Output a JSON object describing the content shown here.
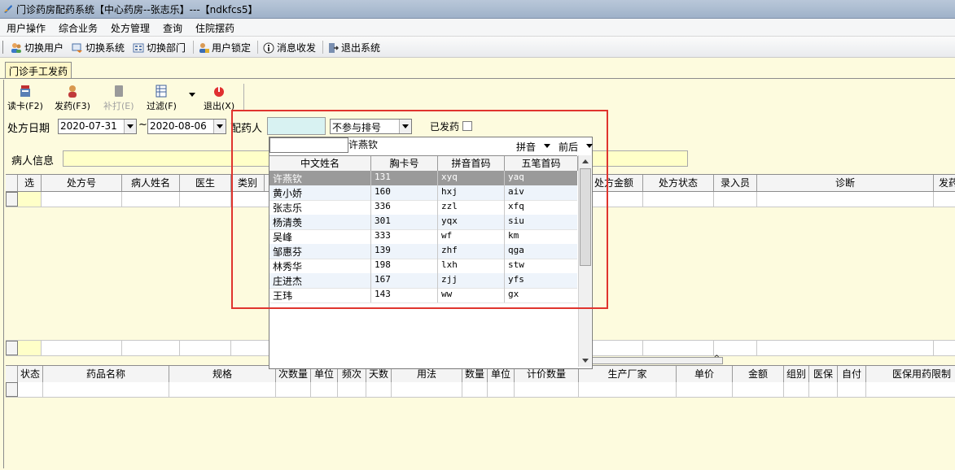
{
  "window": {
    "title": "门诊药房配药系统【中心药房--张志乐】---【ndkfcs5】"
  },
  "menu": [
    "用户操作",
    "综合业务",
    "处方管理",
    "查询",
    "住院摆药"
  ],
  "toolbar": {
    "switch_user": "切换用户",
    "switch_system": "切换系统",
    "switch_dept": "切换部门",
    "user_lock": "用户锁定",
    "message": "消息收发",
    "exit_system": "退出系统"
  },
  "tab": {
    "label": "门诊手工发药"
  },
  "actions": {
    "read_card": "读卡(F2)",
    "dispense": "发药(F3)",
    "reprint": "补打(E)",
    "filter": "过滤(F)",
    "exit": "退出(X)"
  },
  "filters": {
    "date_label": "处方日期",
    "date_from": "2020-07-31",
    "tilde": "~",
    "date_to": "2020-08-06",
    "pharmacist_label": "配药人",
    "pharmacist_value": "",
    "queue_option": "不参与排号",
    "dispensed_label": "已发药",
    "patient_info_label": "病人信息"
  },
  "rx_grid": {
    "columns": [
      "选",
      "处方号",
      "病人姓名",
      "医生",
      "类别",
      "处方金额",
      "处方状态",
      "录入员",
      "诊断",
      "发药"
    ]
  },
  "drug_grid": {
    "columns": [
      "状态",
      "药品名称",
      "规格",
      "次数量",
      "单位",
      "频次",
      "天数",
      "用法",
      "数量",
      "单位",
      "计价数量",
      "生产厂家",
      "单价",
      "金额",
      "组别",
      "医保",
      "自付",
      "医保用药限制"
    ]
  },
  "popup": {
    "search_value": "",
    "search_display": "许燕钦",
    "match_mode": "拼音",
    "match_pos": "前后",
    "columns": [
      "中文姓名",
      "胸卡号",
      "拼音首码",
      "五笔首码"
    ],
    "rows": [
      {
        "name": "许燕钦",
        "card": "131",
        "pinyin": "xyq",
        "wubi": "yaq",
        "selected": true
      },
      {
        "name": "黄小娇",
        "card": "160",
        "pinyin": "hxj",
        "wubi": "aiv"
      },
      {
        "name": "张志乐",
        "card": "336",
        "pinyin": "zzl",
        "wubi": "xfq"
      },
      {
        "name": "杨清羡",
        "card": "301",
        "pinyin": "yqx",
        "wubi": "siu"
      },
      {
        "name": "吴峰",
        "card": "333",
        "pinyin": "wf",
        "wubi": "km"
      },
      {
        "name": "邹惠芬",
        "card": "139",
        "pinyin": "zhf",
        "wubi": "qga"
      },
      {
        "name": "林秀华",
        "card": "198",
        "pinyin": "lxh",
        "wubi": "stw"
      },
      {
        "name": "庄进杰",
        "card": "167",
        "pinyin": "zjj",
        "wubi": "yfs"
      },
      {
        "name": "王玮",
        "card": "143",
        "pinyin": "ww",
        "wubi": "gx"
      }
    ]
  },
  "colors": {
    "highlight": "#e0342e",
    "selected_row": "#9a9a9a",
    "alt_row": "#eef4fb",
    "yellow_field": "#ffffc8"
  }
}
